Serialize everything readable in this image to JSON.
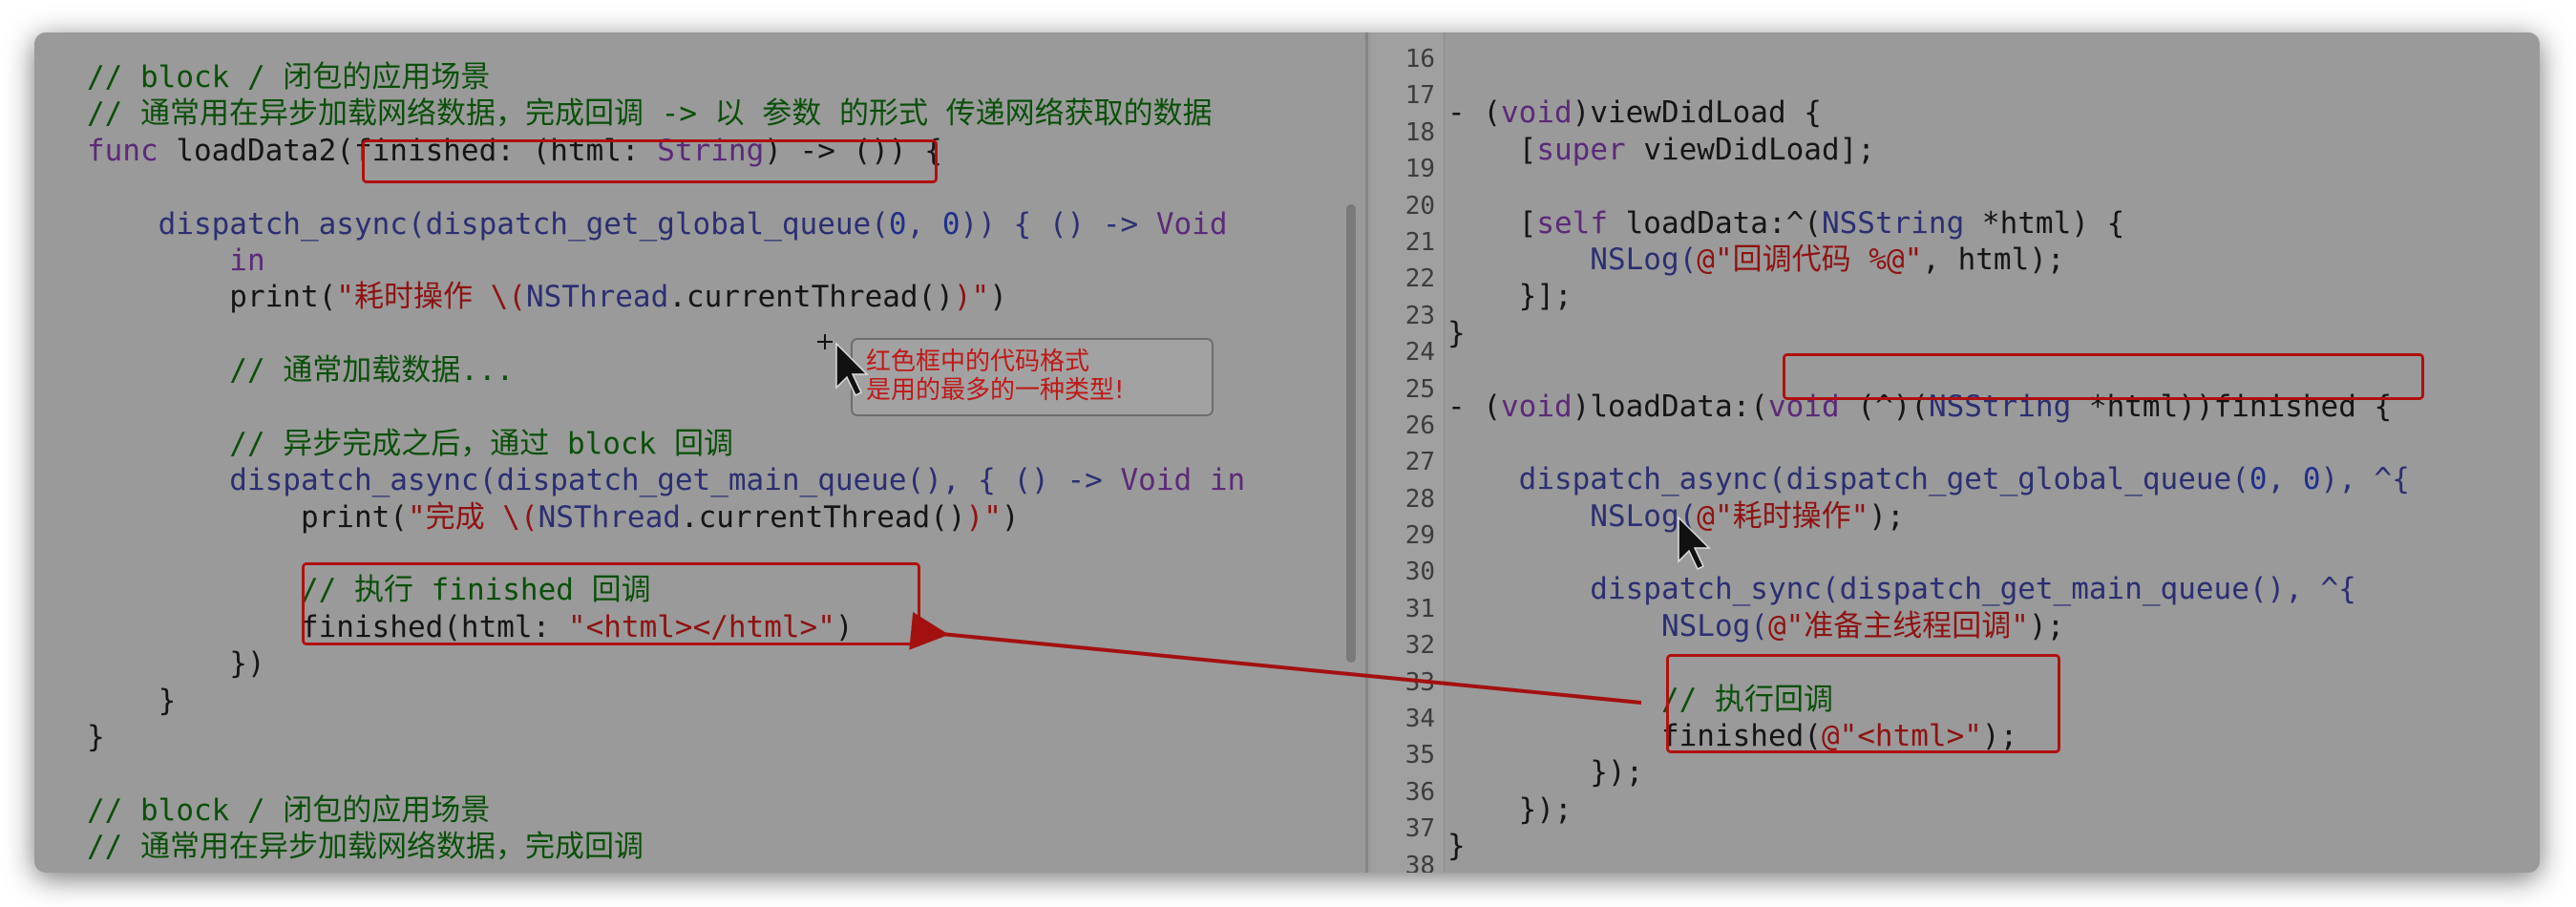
{
  "left_pane": {
    "lines": [
      [
        {
          "t": "// block / 闭包的应用场景",
          "c": "c-comment"
        }
      ],
      [
        {
          "t": "// 通常用在异步加载网络数据，完成回调 -> 以 参数 的形式 传递网络获取的数据",
          "c": "c-comment"
        }
      ],
      [
        {
          "t": "func",
          "c": "c-kw"
        },
        {
          "t": " loadData2(finished: (html: ",
          "c": "c-plain"
        },
        {
          "t": "String",
          "c": "c-kw"
        },
        {
          "t": ") -> ()) {",
          "c": "c-plain"
        }
      ],
      [
        {
          "t": "",
          "c": "c-plain"
        }
      ],
      [
        {
          "t": "    dispatch_async(dispatch_get_global_queue(",
          "c": "c-type"
        },
        {
          "t": "0",
          "c": "c-num"
        },
        {
          "t": ", ",
          "c": "c-type"
        },
        {
          "t": "0",
          "c": "c-num"
        },
        {
          "t": ")) { () -> ",
          "c": "c-type"
        },
        {
          "t": "Void",
          "c": "c-kw"
        }
      ],
      [
        {
          "t": "        in",
          "c": "c-kw"
        }
      ],
      [
        {
          "t": "        print(",
          "c": "c-plain"
        },
        {
          "t": "\"耗时操作 \\(",
          "c": "c-str"
        },
        {
          "t": "NSThread",
          "c": "c-type"
        },
        {
          "t": ".currentThread()",
          "c": "c-plain"
        },
        {
          "t": ")\"",
          "c": "c-str"
        },
        {
          "t": ")",
          "c": "c-plain"
        }
      ],
      [
        {
          "t": "",
          "c": "c-plain"
        }
      ],
      [
        {
          "t": "        // 通常加载数据...",
          "c": "c-comment"
        }
      ],
      [
        {
          "t": "",
          "c": "c-plain"
        }
      ],
      [
        {
          "t": "        // 异步完成之后，通过 block 回调",
          "c": "c-comment"
        }
      ],
      [
        {
          "t": "        dispatch_async(dispatch_get_main_queue(), { () -> ",
          "c": "c-type"
        },
        {
          "t": "Void in",
          "c": "c-kw"
        }
      ],
      [
        {
          "t": "            print(",
          "c": "c-plain"
        },
        {
          "t": "\"完成 \\(",
          "c": "c-str"
        },
        {
          "t": "NSThread",
          "c": "c-type"
        },
        {
          "t": ".currentThread()",
          "c": "c-plain"
        },
        {
          "t": ")\"",
          "c": "c-str"
        },
        {
          "t": ")",
          "c": "c-plain"
        }
      ],
      [
        {
          "t": "",
          "c": "c-plain"
        }
      ],
      [
        {
          "t": "            // 执行 finished 回调",
          "c": "c-comment"
        }
      ],
      [
        {
          "t": "            finished(html: ",
          "c": "c-plain"
        },
        {
          "t": "\"<html></html>\"",
          "c": "c-str"
        },
        {
          "t": ")",
          "c": "c-plain"
        }
      ],
      [
        {
          "t": "        })",
          "c": "c-plain"
        }
      ],
      [
        {
          "t": "    }",
          "c": "c-plain"
        }
      ],
      [
        {
          "t": "}",
          "c": "c-plain"
        }
      ],
      [
        {
          "t": "",
          "c": "c-plain"
        }
      ],
      [
        {
          "t": "// block / 闭包的应用场景",
          "c": "c-comment"
        }
      ],
      [
        {
          "t": "// 通常用在异步加载网络数据，完成回调",
          "c": "c-comment"
        }
      ]
    ]
  },
  "right_pane": {
    "line_numbers": [
      "16",
      "17",
      "18",
      "19",
      "20",
      "21",
      "22",
      "23",
      "24",
      "25",
      "26",
      "27",
      "28",
      "29",
      "30",
      "31",
      "32",
      "33",
      "34",
      "35",
      "36",
      "37",
      "38"
    ],
    "lines": [
      [
        {
          "t": "",
          "c": "c-plain"
        }
      ],
      [
        {
          "t": "- (",
          "c": "c-plain"
        },
        {
          "t": "void",
          "c": "c-kw"
        },
        {
          "t": ")viewDidLoad {",
          "c": "c-plain"
        }
      ],
      [
        {
          "t": "    [",
          "c": "c-plain"
        },
        {
          "t": "super",
          "c": "c-kw"
        },
        {
          "t": " viewDidLoad];",
          "c": "c-plain"
        }
      ],
      [
        {
          "t": "",
          "c": "c-plain"
        }
      ],
      [
        {
          "t": "    [",
          "c": "c-plain"
        },
        {
          "t": "self",
          "c": "c-kw"
        },
        {
          "t": " loadData:^(",
          "c": "c-plain"
        },
        {
          "t": "NSString",
          "c": "c-type"
        },
        {
          "t": " *html) {",
          "c": "c-plain"
        }
      ],
      [
        {
          "t": "        NSLog(",
          "c": "c-type"
        },
        {
          "t": "@\"回调代码 %@\"",
          "c": "c-str"
        },
        {
          "t": ", html);",
          "c": "c-plain"
        }
      ],
      [
        {
          "t": "    }];",
          "c": "c-plain"
        }
      ],
      [
        {
          "t": "}",
          "c": "c-plain"
        }
      ],
      [
        {
          "t": "",
          "c": "c-plain"
        }
      ],
      [
        {
          "t": "- (",
          "c": "c-plain"
        },
        {
          "t": "void",
          "c": "c-kw"
        },
        {
          "t": ")loadData:(",
          "c": "c-plain"
        },
        {
          "t": "void",
          "c": "c-kw"
        },
        {
          "t": " (^)(",
          "c": "c-plain"
        },
        {
          "t": "NSString",
          "c": "c-type"
        },
        {
          "t": " *html))finished {",
          "c": "c-plain"
        }
      ],
      [
        {
          "t": "",
          "c": "c-plain"
        }
      ],
      [
        {
          "t": "    dispatch_async(dispatch_get_global_queue(",
          "c": "c-type"
        },
        {
          "t": "0",
          "c": "c-num"
        },
        {
          "t": ", ",
          "c": "c-type"
        },
        {
          "t": "0",
          "c": "c-num"
        },
        {
          "t": "), ^{",
          "c": "c-type"
        }
      ],
      [
        {
          "t": "        NSLog(",
          "c": "c-type"
        },
        {
          "t": "@\"耗时操作\"",
          "c": "c-str"
        },
        {
          "t": ");",
          "c": "c-plain"
        }
      ],
      [
        {
          "t": "",
          "c": "c-plain"
        }
      ],
      [
        {
          "t": "        dispatch_sync(dispatch_get_main_queue(), ^{",
          "c": "c-type"
        }
      ],
      [
        {
          "t": "            NSLog(",
          "c": "c-type"
        },
        {
          "t": "@\"准备主线程回调\"",
          "c": "c-str"
        },
        {
          "t": ");",
          "c": "c-plain"
        }
      ],
      [
        {
          "t": "",
          "c": "c-plain"
        }
      ],
      [
        {
          "t": "            // 执行回调",
          "c": "c-comment"
        }
      ],
      [
        {
          "t": "            finished(",
          "c": "c-plain"
        },
        {
          "t": "@\"<html>\"",
          "c": "c-str"
        },
        {
          "t": ");",
          "c": "c-plain"
        }
      ],
      [
        {
          "t": "        });",
          "c": "c-plain"
        }
      ],
      [
        {
          "t": "    });",
          "c": "c-plain"
        }
      ],
      [
        {
          "t": "}",
          "c": "c-plain"
        }
      ],
      [
        {
          "t": "",
          "c": "c-plain"
        }
      ]
    ]
  },
  "annotation": {
    "line1": "红色框中的代码格式",
    "line2": "是用的最多的一种类型!"
  },
  "colors": {
    "highlight_box": "#b01010",
    "arrow": "#a31010",
    "annotation_text": "#c01818"
  }
}
